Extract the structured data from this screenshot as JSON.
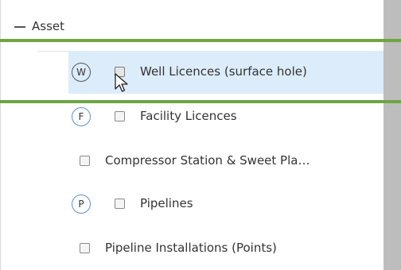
{
  "tree": {
    "group_label": "Asset",
    "items": [
      {
        "badge": "W",
        "label": "Well Licences (surface hole)",
        "selected": true
      },
      {
        "badge": "F",
        "label": "Facility Licences",
        "selected": false
      },
      {
        "badge": "",
        "label": "Compressor Station & Sweet Pla…",
        "selected": false
      },
      {
        "badge": "P",
        "label": "Pipelines",
        "selected": false
      },
      {
        "badge": "",
        "label": "Pipeline Installations (Points)",
        "selected": false
      }
    ]
  },
  "colors": {
    "highlight_band": "#6fa344",
    "selected_row_bg": "#dcecfa",
    "badge_ring": "#5b8fd6",
    "scrollbar": "#bdbdbd"
  },
  "icons": {
    "collapse": "minus-icon",
    "cursor": "mouse-pointer-icon"
  }
}
